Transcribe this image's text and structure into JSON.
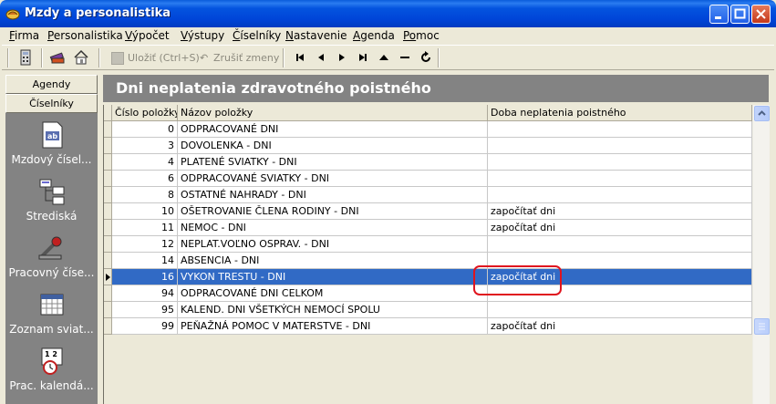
{
  "window": {
    "title": "Mzdy a personalistika",
    "buttons": {
      "minimize": "_",
      "maximize": "□",
      "close": "✕"
    }
  },
  "menu": [
    {
      "id": "firma",
      "ul": "F",
      "rest": "irma"
    },
    {
      "id": "personalistika",
      "ul": "P",
      "rest": "ersonalistika"
    },
    {
      "id": "vypocet",
      "ul": "V",
      "rest": "ýpočet"
    },
    {
      "id": "vystupy",
      "ul": "V",
      "rest": "ýstupy"
    },
    {
      "id": "ciselniky",
      "ul": "Č",
      "rest": "íselníky"
    },
    {
      "id": "nastavenie",
      "ul": "N",
      "rest": "astavenie"
    },
    {
      "id": "agenda",
      "ul": "A",
      "rest": "genda"
    },
    {
      "id": "pomoc",
      "ul": "Po",
      "rest": "moc"
    }
  ],
  "toolbar": {
    "save_label": "Uložiť (Ctrl+S)",
    "cancel_label": "Zrušiť zmeny",
    "nav": {
      "first": "⏮",
      "prev": "◀",
      "next": "▶",
      "last": "⏭",
      "insert": "▲",
      "delete": "━",
      "refresh": "↻"
    }
  },
  "sidebar": {
    "tab_agendy": "Agendy",
    "tab_ciselniky": "Číselníky",
    "items": [
      {
        "label": "Mzdový čísel...",
        "icon": "document-ab-icon"
      },
      {
        "label": "Strediská",
        "icon": "org-chart-icon"
      },
      {
        "label": "Pracovný číse...",
        "icon": "wrench-icon"
      },
      {
        "label": "Zoznam sviat...",
        "icon": "calendar-icon"
      },
      {
        "label": "Prac. kalendá...",
        "icon": "clock-calendar-icon"
      }
    ]
  },
  "main": {
    "title": "Dni neplatenia zdravotného poistného"
  },
  "table": {
    "columns": [
      "Číslo položky",
      "Názov položky",
      "Doba neplatenia poistného"
    ],
    "rows": [
      {
        "cislo": "0",
        "nazov": "ODPRACOVANÉ DNI",
        "doba": ""
      },
      {
        "cislo": "3",
        "nazov": "DOVOLENKA - DNI",
        "doba": ""
      },
      {
        "cislo": "4",
        "nazov": "PLATENÉ SVIATKY - DNI",
        "doba": ""
      },
      {
        "cislo": "6",
        "nazov": "ODPRACOVANÉ SVIATKY - DNI",
        "doba": ""
      },
      {
        "cislo": "8",
        "nazov": "OSTATNÉ NAHRADY - DNI",
        "doba": ""
      },
      {
        "cislo": "10",
        "nazov": "OŠETROVANIE ČLENA RODINY - DNI",
        "doba": "započítať dni"
      },
      {
        "cislo": "11",
        "nazov": "NEMOC - DNI",
        "doba": "započítať dni"
      },
      {
        "cislo": "12",
        "nazov": "NEPLAT.VOĽNO OSPRAV. - DNI",
        "doba": ""
      },
      {
        "cislo": "14",
        "nazov": "ABSENCIA - DNI",
        "doba": ""
      },
      {
        "cislo": "16",
        "nazov": "VYKON TRESTU - DNI",
        "doba": "započítať dni",
        "selected": true
      },
      {
        "cislo": "94",
        "nazov": "ODPRACOVANÉ DNI CELKOM",
        "doba": ""
      },
      {
        "cislo": "95",
        "nazov": "KALEND. DNI VŠETKÝCH NEMOCÍ SPOLU",
        "doba": ""
      },
      {
        "cislo": "99",
        "nazov": "PEŇAŽNÁ POMOC V MATERSTVE - DNI",
        "doba": "započítať dni"
      }
    ]
  },
  "colors": {
    "selection": "#316ac5",
    "highlight_ring": "#e0141e",
    "panel_gray": "#838383"
  }
}
